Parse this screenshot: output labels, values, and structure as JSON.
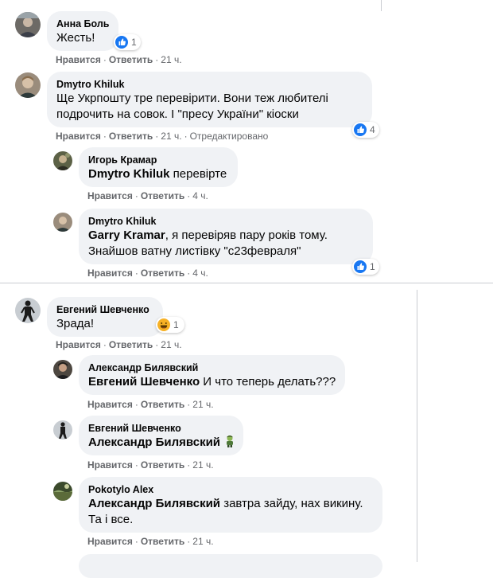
{
  "colors": {
    "bubble": "#f0f2f5",
    "meta": "#65676b",
    "like": "#1877f2",
    "haha": "#f7b125",
    "separator": "#c9ccd1"
  },
  "comments": [
    {
      "author": "Анна Боль",
      "text": "Жесть!",
      "reaction": {
        "icon": "like-icon",
        "count": "1"
      },
      "actions": {
        "like": "Нравится",
        "reply": "Ответить",
        "time": "21 ч."
      }
    },
    {
      "author": "Dmytro Khiluk",
      "text_lines": [
        "Ще Укрпошту тре перевірити. Вони теж любителі",
        "подрочить на совок. І \"пресу України\" кіоски"
      ],
      "reaction": {
        "icon": "like-icon",
        "count": "4"
      },
      "actions": {
        "like": "Нравится",
        "reply": "Ответить",
        "time": "21 ч.",
        "edited": "Отредактировано"
      }
    },
    {
      "author": "Игорь Крамар",
      "mention": "Dmytro Khiluk",
      "text": " перевірте",
      "actions": {
        "like": "Нравится",
        "reply": "Ответить",
        "time": "4 ч."
      }
    },
    {
      "author": "Dmytro Khiluk",
      "mention": "Garry Kramar",
      "text_lines": [
        ", я перевіряв пару років тому.",
        "Знайшов ватну листівку \"с23февраля\""
      ],
      "reaction": {
        "icon": "like-icon",
        "count": "1"
      },
      "actions": {
        "like": "Нравится",
        "reply": "Ответить",
        "time": "4 ч."
      }
    },
    {
      "author": "Евгений Шевченко",
      "text": "Зрада!",
      "reaction": {
        "icon": "haha-icon",
        "count": "1"
      },
      "actions": {
        "like": "Нравится",
        "reply": "Ответить",
        "time": "21 ч."
      }
    },
    {
      "author": "Александр Билявский",
      "mention": "Евгений Шевченко",
      "text": " И что теперь делать???",
      "actions": {
        "like": "Нравится",
        "reply": "Ответить",
        "time": "21 ч."
      }
    },
    {
      "author": "Евгений Шевченко",
      "mention": "Александр Билявский",
      "emoji": "zombie-man-icon",
      "actions": {
        "like": "Нравится",
        "reply": "Ответить",
        "time": "21 ч."
      }
    },
    {
      "author": "Pokotylo Alex",
      "mention": "Александр Билявский",
      "text_lines": [
        " завтра зайду, нах викину.",
        "Та і все."
      ],
      "actions": {
        "like": "Нравится",
        "reply": "Ответить",
        "time": "21 ч."
      }
    }
  ]
}
